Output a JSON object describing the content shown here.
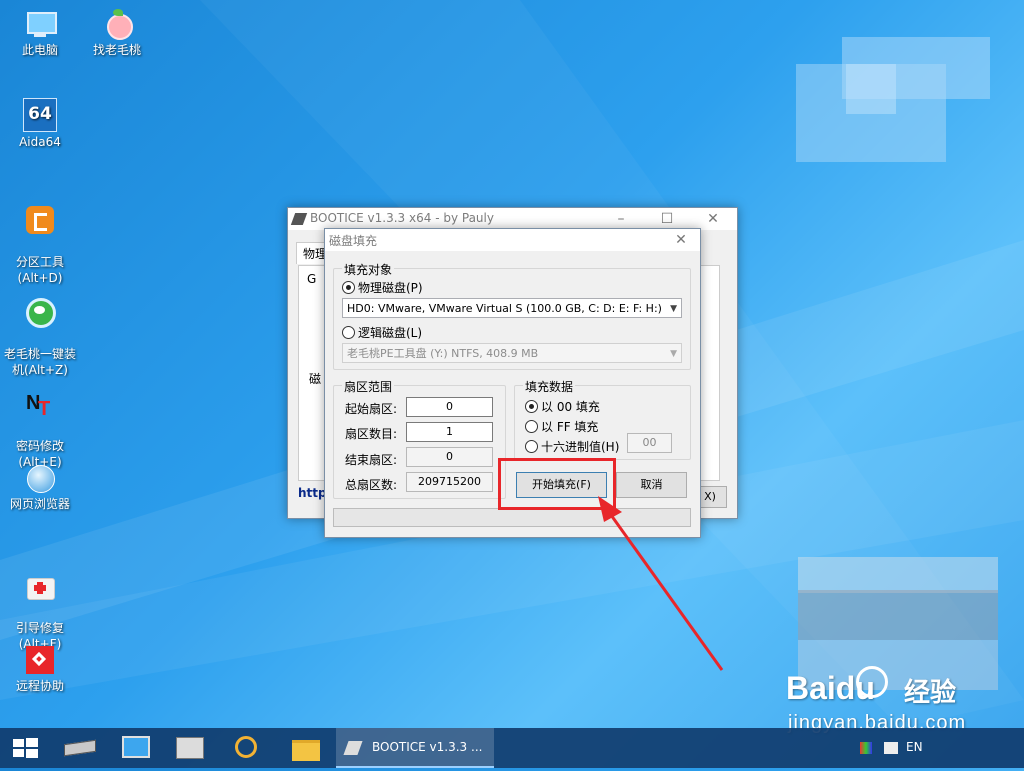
{
  "desktop": {
    "icons": [
      {
        "label": "此电脑",
        "icon": "computer-icon"
      },
      {
        "label": "找老毛桃",
        "icon": "peach-icon"
      },
      {
        "label": "Aida64",
        "icon": "aida64-icon",
        "glyph": "64"
      },
      {
        "label": "分区工具\n(Alt+D)",
        "icon": "partition-tool-icon"
      },
      {
        "label": "老毛桃一键装\n机(Alt+Z)",
        "icon": "one-key-install-icon"
      },
      {
        "label": "密码修改\n(Alt+E)",
        "icon": "password-tool-icon"
      },
      {
        "label": "网页浏览器",
        "icon": "browser-icon"
      },
      {
        "label": "引导修复\n(Alt+F)",
        "icon": "boot-repair-icon"
      },
      {
        "label": "远程协助",
        "icon": "remote-assist-icon"
      }
    ]
  },
  "bootice": {
    "title": "BOOTICE v1.3.3 x64 - by Pauly",
    "tab_partial": "物理",
    "group1_partial": "G",
    "group2_partial": "磁",
    "link_partial": "http",
    "close_hint": "X)"
  },
  "dialog": {
    "title": "磁盘填充",
    "target_group": "填充对象",
    "physical_radio": "物理磁盘(P)",
    "physical_disk": "HD0: VMware, VMware Virtual S (100.0 GB, C: D: E: F: H:)",
    "logical_radio": "逻辑磁盘(L)",
    "logical_disk": "老毛桃PE工具盘 (Y:)  NTFS, 408.9 MB",
    "range_group": "扇区范围",
    "start_label": "起始扇区:",
    "start_value": "0",
    "count_label": "扇区数目:",
    "count_value": "1",
    "end_label": "结束扇区:",
    "end_value": "0",
    "total_label": "总扇区数:",
    "total_value": "209715200",
    "data_group": "填充数据",
    "fill00": "以 00 填充",
    "fillFF": "以 FF 填充",
    "fillHex": "十六进制值(H)",
    "hex_value": "00",
    "start_button": "开始填充(F)",
    "cancel_button": "取消"
  },
  "taskbar": {
    "app_label": "BOOTICE v1.3.3 ...",
    "tray_lang": "EN"
  },
  "watermark": {
    "logo_text": "Baidu",
    "logo_sub": "经验",
    "url": "jingyan.baidu.com"
  },
  "colors": {
    "highlight_red": "#e8262a",
    "desktop_blue": "#2da0ee",
    "taskbar": "#103c6e"
  }
}
